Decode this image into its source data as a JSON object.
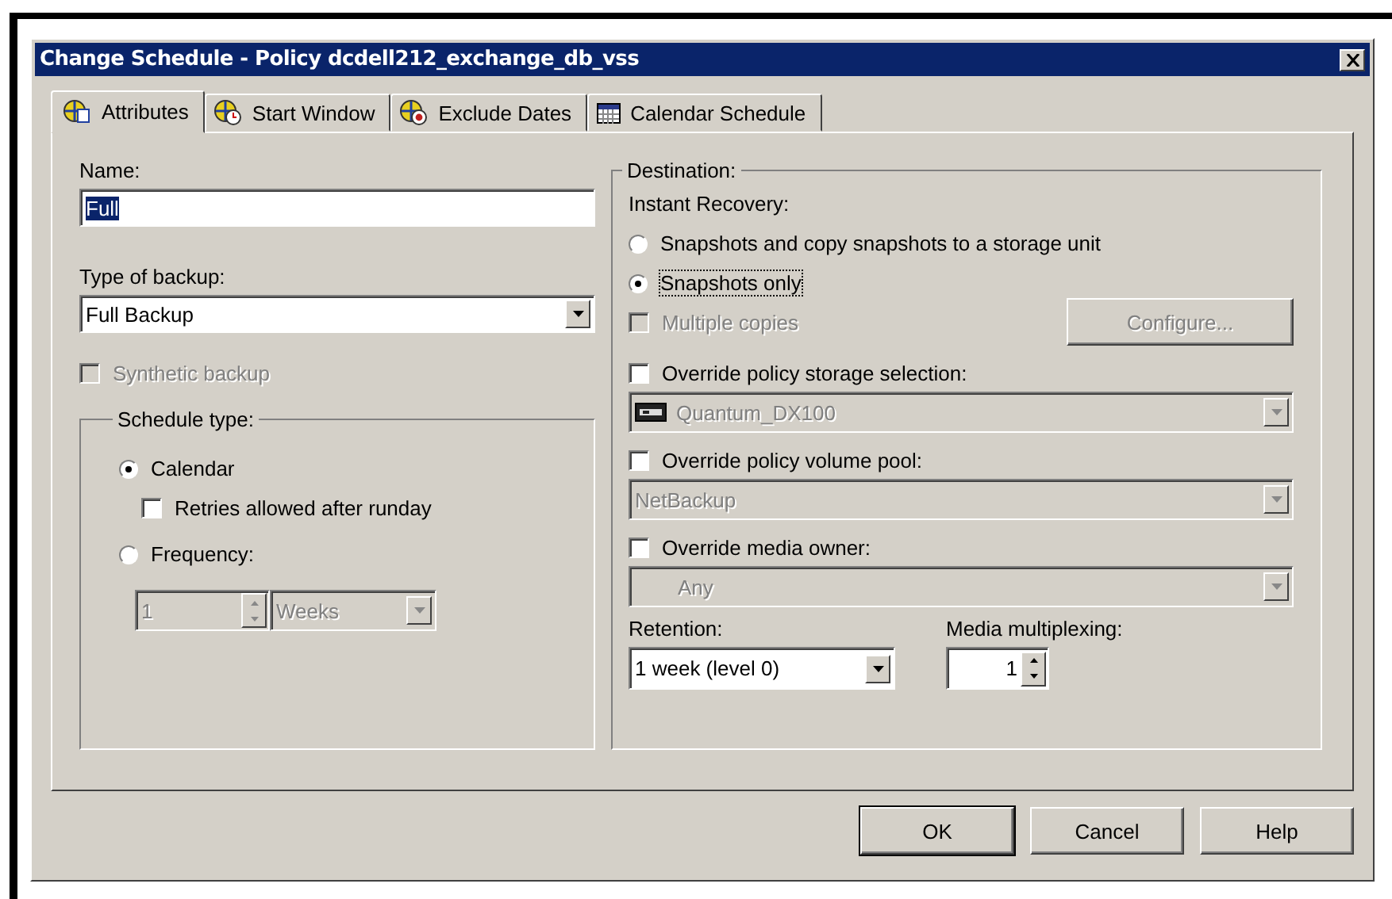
{
  "window": {
    "title": "Change Schedule - Policy dcdell212_exchange_db_vss"
  },
  "tabs": [
    {
      "label": "Attributes",
      "selected": true,
      "kind": "globe"
    },
    {
      "label": "Start Window",
      "selected": false,
      "kind": "clock"
    },
    {
      "label": "Exclude Dates",
      "selected": false,
      "kind": "exclude"
    },
    {
      "label": "Calendar Schedule",
      "selected": false,
      "kind": "calendar"
    }
  ],
  "name": {
    "label": "Name:",
    "value": "Full",
    "value_selected": true
  },
  "type_of_backup": {
    "label": "Type of backup:",
    "value": "Full Backup"
  },
  "synthetic_backup": {
    "label": "Synthetic backup",
    "checked": false,
    "disabled": true
  },
  "schedule_type": {
    "title": "Schedule type:",
    "calendar": {
      "label": "Calendar",
      "selected": true
    },
    "retries": {
      "label": "Retries allowed after runday",
      "checked": false
    },
    "frequency": {
      "label": "Frequency:",
      "selected": false
    },
    "frequency_value": {
      "value": "1",
      "unit": "Weeks",
      "disabled": true
    }
  },
  "destination": {
    "title": "Destination:",
    "instant_recovery": "Instant Recovery:",
    "options": [
      {
        "label": "Snapshots and copy snapshots to a storage unit",
        "selected": false,
        "focused": false
      },
      {
        "label": "Snapshots only",
        "selected": true,
        "focused": true
      }
    ],
    "multiple_copies": {
      "label": "Multiple copies",
      "checked": false,
      "disabled": true
    },
    "configure": {
      "label": "Configure...",
      "disabled": true
    },
    "overrides": [
      {
        "label": "Override policy storage selection:",
        "checked": false,
        "value": "Quantum_DX100",
        "disabled": true,
        "kind": "device"
      },
      {
        "label": "Override policy volume pool:",
        "checked": false,
        "value": "NetBackup",
        "disabled": true,
        "kind": "plain"
      },
      {
        "label": "Override media owner:",
        "checked": false,
        "value": "Any",
        "disabled": true,
        "kind": "indented"
      }
    ],
    "retention": {
      "label": "Retention:",
      "value": "1 week (level 0)"
    },
    "multiplexing": {
      "label": "Media multiplexing:",
      "value": "1"
    }
  },
  "buttons": [
    {
      "label": "OK",
      "default": true
    },
    {
      "label": "Cancel",
      "default": false
    },
    {
      "label": "Help",
      "default": false
    }
  ]
}
